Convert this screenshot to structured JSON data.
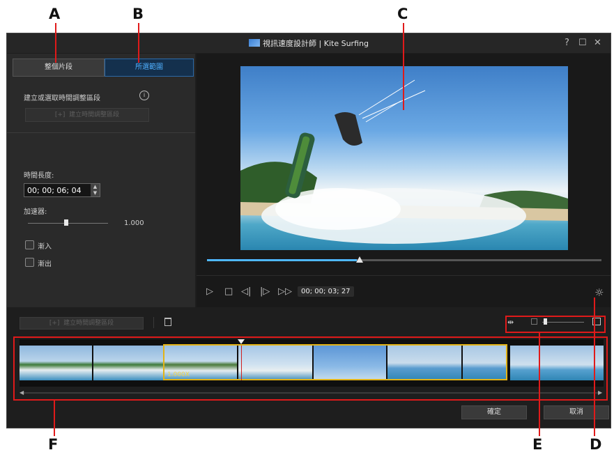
{
  "window": {
    "title": "視訊速度設計師 | Kite Surfing",
    "help": "?",
    "maximize": "☐",
    "close": "✕"
  },
  "callouts": {
    "a": "A",
    "b": "B",
    "c": "C",
    "d": "D",
    "e": "E",
    "f": "F"
  },
  "tabs": {
    "entire_clip": "整個片段",
    "selected_range": "所選範圍"
  },
  "left_panel": {
    "instruction": "建立或選取時間調整區段",
    "info_icon": "i",
    "create_button": "建立時間調整區段",
    "duration_label": "時間長度:",
    "duration_value": "00; 00; 06; 04",
    "accelerator_label": "加速器:",
    "accelerator_value": "1.000",
    "fade_in": "漸入",
    "fade_out": "漸出"
  },
  "player": {
    "timecode": "00; 00; 03; 27",
    "progress": 0.38,
    "icons": {
      "play": "▷",
      "stop": "□",
      "prev_frame": "◁|",
      "next_frame": "|▷",
      "fast_forward": "▷▷",
      "settings": "☼"
    }
  },
  "timeline": {
    "create_button": "建立時間調整區段",
    "delete_icon": "trash-icon",
    "zoom_level": 0.06,
    "clip_speed_label": "1.000X"
  },
  "footer": {
    "ok": "確定",
    "cancel": "取消"
  },
  "colors": {
    "accent": "#4fb8ff",
    "callout_line": "#e01a1a",
    "selection": "#e3b316"
  }
}
